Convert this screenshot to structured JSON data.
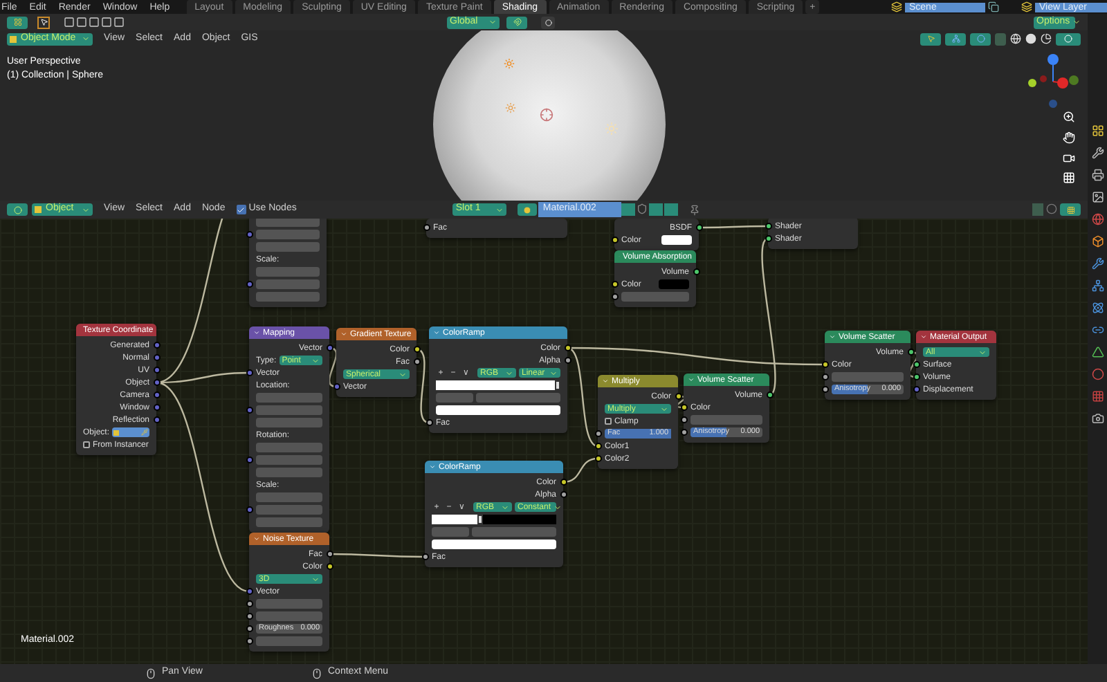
{
  "menu_bar": {
    "menus": [
      "File",
      "Edit",
      "Render",
      "Window",
      "Help"
    ],
    "workspaces": [
      {
        "label": "Layout",
        "selected": false
      },
      {
        "label": "Modeling",
        "selected": false
      },
      {
        "label": "Sculpting",
        "selected": false
      },
      {
        "label": "UV Editing",
        "selected": false
      },
      {
        "label": "Texture Paint",
        "selected": false
      },
      {
        "label": "Shading",
        "selected": true
      },
      {
        "label": "Animation",
        "selected": false
      },
      {
        "label": "Rendering",
        "selected": false
      },
      {
        "label": "Compositing",
        "selected": false
      },
      {
        "label": "Scripting",
        "selected": false
      }
    ],
    "add_workspace": "+",
    "scene": "Scene",
    "view_layer": "View Layer"
  },
  "viewport": {
    "orientation": "Global",
    "options": "Options",
    "mode": "Object Mode",
    "menus": [
      "View",
      "Select",
      "Add",
      "Object",
      "GIS"
    ],
    "overlay_text": [
      "User Perspective",
      "(1) Collection | Sphere"
    ]
  },
  "node_editor": {
    "header": {
      "type": "Object",
      "menus": [
        "View",
        "Select",
        "Add",
        "Node"
      ],
      "use_nodes": {
        "label": "Use Nodes",
        "checked": true
      },
      "slot": "Slot 1",
      "material": "Material.002"
    },
    "nodes": [
      {
        "rows": [
          {
            "kind": "field"
          },
          {
            "kind": "field",
            "socket": {
              "kind": "vector"
            }
          },
          {
            "kind": "field"
          },
          {
            "kind": "label",
            "text": "Scale:"
          },
          {
            "kind": "field"
          },
          {
            "kind": "field",
            "socket": {
              "kind": "vector"
            }
          },
          {
            "kind": "field"
          }
        ]
      },
      {
        "rows": [
          {
            "kind": "input",
            "text": "Fac",
            "socket": {
              "kind": "float"
            }
          }
        ]
      },
      {
        "rows": [
          {
            "kind": "output",
            "text": "BSDF",
            "socket": {
              "kind": "shader"
            }
          },
          {
            "kind": "swatch",
            "text": "Color",
            "color": "#ffffff",
            "socket": {
              "kind": "color"
            }
          }
        ]
      },
      {
        "rows": [
          {
            "kind": "input",
            "text": "Shader",
            "socket": {
              "kind": "shader"
            }
          },
          {
            "kind": "input",
            "text": "Shader",
            "socket": {
              "kind": "shader"
            }
          }
        ]
      },
      {
        "title": "Volume Absorption",
        "color": "#2b8a5c",
        "rows": [
          {
            "kind": "output",
            "text": "Volume",
            "socket": {
              "kind": "shader"
            }
          },
          {
            "kind": "swatch",
            "text": "Color",
            "color": "#000000",
            "socket": {
              "kind": "color"
            }
          },
          {
            "kind": "field",
            "socket": {
              "kind": "float"
            }
          }
        ]
      },
      {
        "title": "Texture Coordinate",
        "color": "#a3343e",
        "rows": [
          {
            "kind": "output",
            "text": "Generated",
            "socket": {
              "kind": "vector"
            }
          },
          {
            "kind": "output",
            "text": "Normal",
            "socket": {
              "kind": "vector"
            }
          },
          {
            "kind": "output",
            "text": "UV",
            "socket": {
              "kind": "vector"
            }
          },
          {
            "kind": "output",
            "text": "Object",
            "socket": {
              "kind": "vector"
            }
          },
          {
            "kind": "output",
            "text": "Camera",
            "socket": {
              "kind": "vector"
            }
          },
          {
            "kind": "output",
            "text": "Window",
            "socket": {
              "kind": "vector"
            }
          },
          {
            "kind": "output",
            "text": "Reflection",
            "socket": {
              "kind": "vector"
            }
          },
          {
            "kind": "object-field",
            "text": "Object:"
          },
          {
            "kind": "checkbox",
            "text": "From Instancer",
            "checked": false
          }
        ]
      },
      {
        "title": "Mapping",
        "color": "#6a52a8",
        "rows": [
          {
            "kind": "output",
            "text": "Vector",
            "socket": {
              "kind": "vector"
            }
          },
          {
            "kind": "labeled-dropdown",
            "text": "Type:",
            "value": "Point"
          },
          {
            "kind": "input",
            "text": "Vector",
            "socket": {
              "kind": "vector"
            }
          },
          {
            "kind": "label",
            "text": "Location:"
          },
          {
            "kind": "field"
          },
          {
            "kind": "field",
            "socket": {
              "kind": "vector"
            }
          },
          {
            "kind": "field"
          },
          {
            "kind": "label",
            "text": "Rotation:"
          },
          {
            "kind": "field"
          },
          {
            "kind": "field",
            "socket": {
              "kind": "vector"
            }
          },
          {
            "kind": "field"
          },
          {
            "kind": "label",
            "text": "Scale:"
          },
          {
            "kind": "field"
          },
          {
            "kind": "field",
            "socket": {
              "kind": "vector"
            }
          },
          {
            "kind": "field"
          }
        ]
      },
      {
        "title": "Gradient Texture",
        "color": "#b0612a",
        "rows": [
          {
            "kind": "output",
            "text": "Color",
            "socket": {
              "kind": "color"
            }
          },
          {
            "kind": "output",
            "text": "Fac",
            "socket": {
              "kind": "float"
            }
          },
          {
            "kind": "dropdown",
            "text": "Spherical"
          },
          {
            "kind": "input",
            "text": "Vector",
            "socket": {
              "kind": "vector"
            }
          }
        ]
      },
      {
        "title": "ColorRamp",
        "color": "#3a8db3",
        "rows": [
          {
            "kind": "output",
            "text": "Color",
            "socket": {
              "kind": "color"
            }
          },
          {
            "kind": "output",
            "text": "Alpha",
            "socket": {
              "kind": "float"
            }
          },
          {
            "kind": "ramp-tools",
            "buttons": [
              "+",
              "−",
              "∨"
            ],
            "mode": "RGB",
            "interpolation": "Linear"
          },
          {
            "kind": "ramp",
            "level": 1
          },
          {
            "kind": "field-pair"
          },
          {
            "kind": "swatch-bar",
            "color": "#ffffff"
          },
          {
            "kind": "input",
            "text": "Fac",
            "socket": {
              "kind": "float"
            }
          }
        ]
      },
      {
        "title": "Volume Scatter",
        "color": "#2b8a5c",
        "rows": [
          {
            "kind": "output",
            "text": "Volume",
            "socket": {
              "kind": "shader"
            }
          },
          {
            "kind": "input",
            "text": "Color",
            "socket": {
              "kind": "color"
            }
          },
          {
            "kind": "field",
            "socket": {
              "kind": "float"
            }
          },
          {
            "kind": "slider",
            "text": "Anisotropy",
            "value": "0.000",
            "level": 0.5,
            "socket": {
              "kind": "float"
            }
          }
        ]
      },
      {
        "title": "Material Output",
        "color": "#a3343e",
        "rows": [
          {
            "kind": "dropdown",
            "text": "All"
          },
          {
            "kind": "input",
            "text": "Surface",
            "socket": {
              "kind": "shader"
            }
          },
          {
            "kind": "input",
            "text": "Volume",
            "socket": {
              "kind": "shader"
            }
          },
          {
            "kind": "input",
            "text": "Displacement",
            "socket": {
              "kind": "vector"
            }
          }
        ]
      },
      {
        "title": "Multiply",
        "color": "#8b8a2e",
        "rows": [
          {
            "kind": "output",
            "text": "Color",
            "socket": {
              "kind": "color"
            }
          },
          {
            "kind": "dropdown",
            "text": "Multiply"
          },
          {
            "kind": "checkbox",
            "text": "Clamp",
            "checked": false
          },
          {
            "kind": "slider",
            "text": "Fac",
            "value": "1.000",
            "level": 1,
            "socket": {
              "kind": "float"
            }
          },
          {
            "kind": "input",
            "text": "Color1",
            "socket": {
              "kind": "color"
            }
          },
          {
            "kind": "input",
            "text": "Color2",
            "socket": {
              "kind": "color"
            }
          }
        ]
      },
      {
        "title": "Volume Scatter",
        "color": "#2b8a5c",
        "rows": [
          {
            "kind": "output",
            "text": "Volume",
            "socket": {
              "kind": "shader"
            }
          },
          {
            "kind": "input",
            "text": "Color",
            "socket": {
              "kind": "color"
            }
          },
          {
            "kind": "field",
            "socket": {
              "kind": "float"
            }
          },
          {
            "kind": "slider",
            "text": "Anisotropy",
            "value": "0.000",
            "level": 0.5,
            "socket": {
              "kind": "float"
            }
          }
        ]
      },
      {
        "title": "ColorRamp",
        "color": "#3a8db3",
        "rows": [
          {
            "kind": "output",
            "text": "Color",
            "socket": {
              "kind": "color"
            }
          },
          {
            "kind": "output",
            "text": "Alpha",
            "socket": {
              "kind": "float"
            }
          },
          {
            "kind": "ramp-tools",
            "buttons": [
              "+",
              "−",
              "∨"
            ],
            "mode": "RGB",
            "interpolation": "Constant"
          },
          {
            "kind": "ramp",
            "level": 0.38
          },
          {
            "kind": "field-pair"
          },
          {
            "kind": "swatch-bar",
            "color": "#ffffff"
          },
          {
            "kind": "input",
            "text": "Fac",
            "socket": {
              "kind": "float"
            }
          }
        ]
      },
      {
        "title": "Noise Texture",
        "color": "#b0612a",
        "rows": [
          {
            "kind": "output",
            "text": "Fac",
            "socket": {
              "kind": "float"
            }
          },
          {
            "kind": "output",
            "text": "Color",
            "socket": {
              "kind": "color"
            }
          },
          {
            "kind": "dropdown",
            "text": "3D"
          },
          {
            "kind": "input",
            "text": "Vector",
            "socket": {
              "kind": "vector"
            }
          },
          {
            "kind": "field",
            "socket": {
              "kind": "float"
            }
          },
          {
            "kind": "field",
            "socket": {
              "kind": "float"
            }
          },
          {
            "kind": "slider",
            "text": "Roughnes",
            "value": "0.000",
            "level": 0,
            "socket": {
              "kind": "float"
            }
          },
          {
            "kind": "field",
            "socket": {
              "kind": "float"
            }
          }
        ]
      }
    ],
    "material_label": "Material.002"
  },
  "status_bar": [
    "Pan View",
    "Context Menu"
  ]
}
